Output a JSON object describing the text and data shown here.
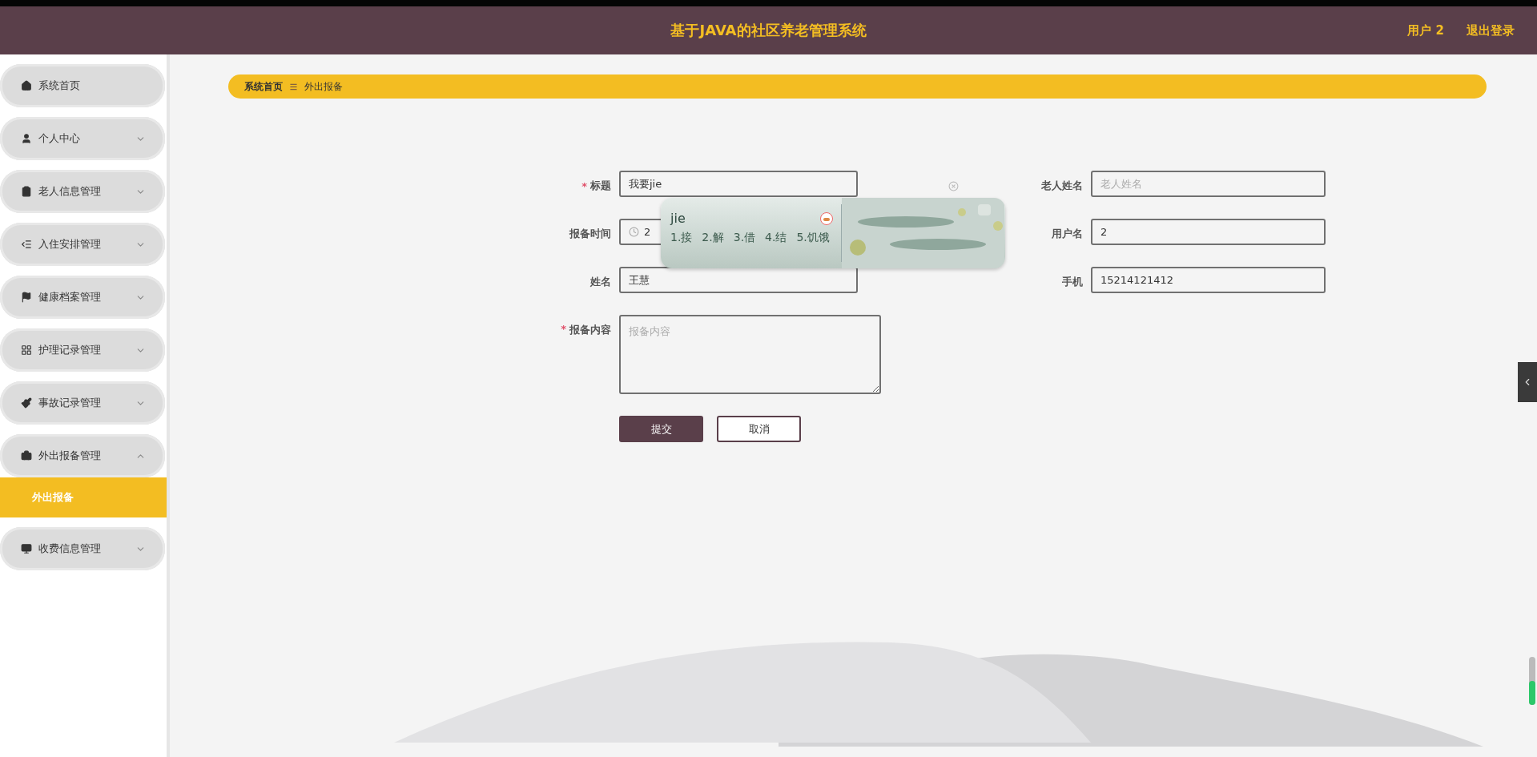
{
  "header": {
    "title": "基于JAVA的社区养老管理系统",
    "user": "用户 2",
    "logout": "退出登录"
  },
  "sidebar": {
    "items": [
      {
        "label": "系统首页",
        "kind": "link"
      },
      {
        "label": "个人中心",
        "kind": "menu",
        "expanded": false
      },
      {
        "label": "老人信息管理",
        "kind": "menu",
        "expanded": false
      },
      {
        "label": "入住安排管理",
        "kind": "menu",
        "expanded": false
      },
      {
        "label": "健康档案管理",
        "kind": "menu",
        "expanded": false
      },
      {
        "label": "护理记录管理",
        "kind": "menu",
        "expanded": false
      },
      {
        "label": "事故记录管理",
        "kind": "menu",
        "expanded": false
      },
      {
        "label": "外出报备管理",
        "kind": "menu",
        "expanded": true,
        "children": [
          {
            "label": "外出报备",
            "selected": true
          }
        ]
      },
      {
        "label": "收费信息管理",
        "kind": "menu",
        "expanded": false
      }
    ]
  },
  "breadcrumb": [
    "系统首页",
    "外出报备"
  ],
  "form": {
    "left": [
      {
        "label": "标题",
        "required": true,
        "value": "我要jie",
        "kind": "text"
      },
      {
        "label": "报备时间",
        "required": false,
        "value": "2",
        "kind": "datetime"
      },
      {
        "label": "姓名",
        "required": false,
        "value": "王慧",
        "kind": "text"
      }
    ],
    "right": [
      {
        "label": "老人姓名",
        "required": false,
        "placeholder": "老人姓名",
        "kind": "text"
      },
      {
        "label": "用户名",
        "required": false,
        "value": "2",
        "kind": "text"
      },
      {
        "label": "手机",
        "required": false,
        "value": "15214121412",
        "kind": "text"
      }
    ],
    "content": {
      "label": "报备内容",
      "required": true,
      "placeholder": "报备内容"
    },
    "required_mark": "*",
    "submit": "提交",
    "cancel": "取消"
  },
  "ime": {
    "input": "jie",
    "candidates": [
      "1.接",
      "2.解",
      "3.借",
      "4.结",
      "5.饥饿"
    ]
  }
}
